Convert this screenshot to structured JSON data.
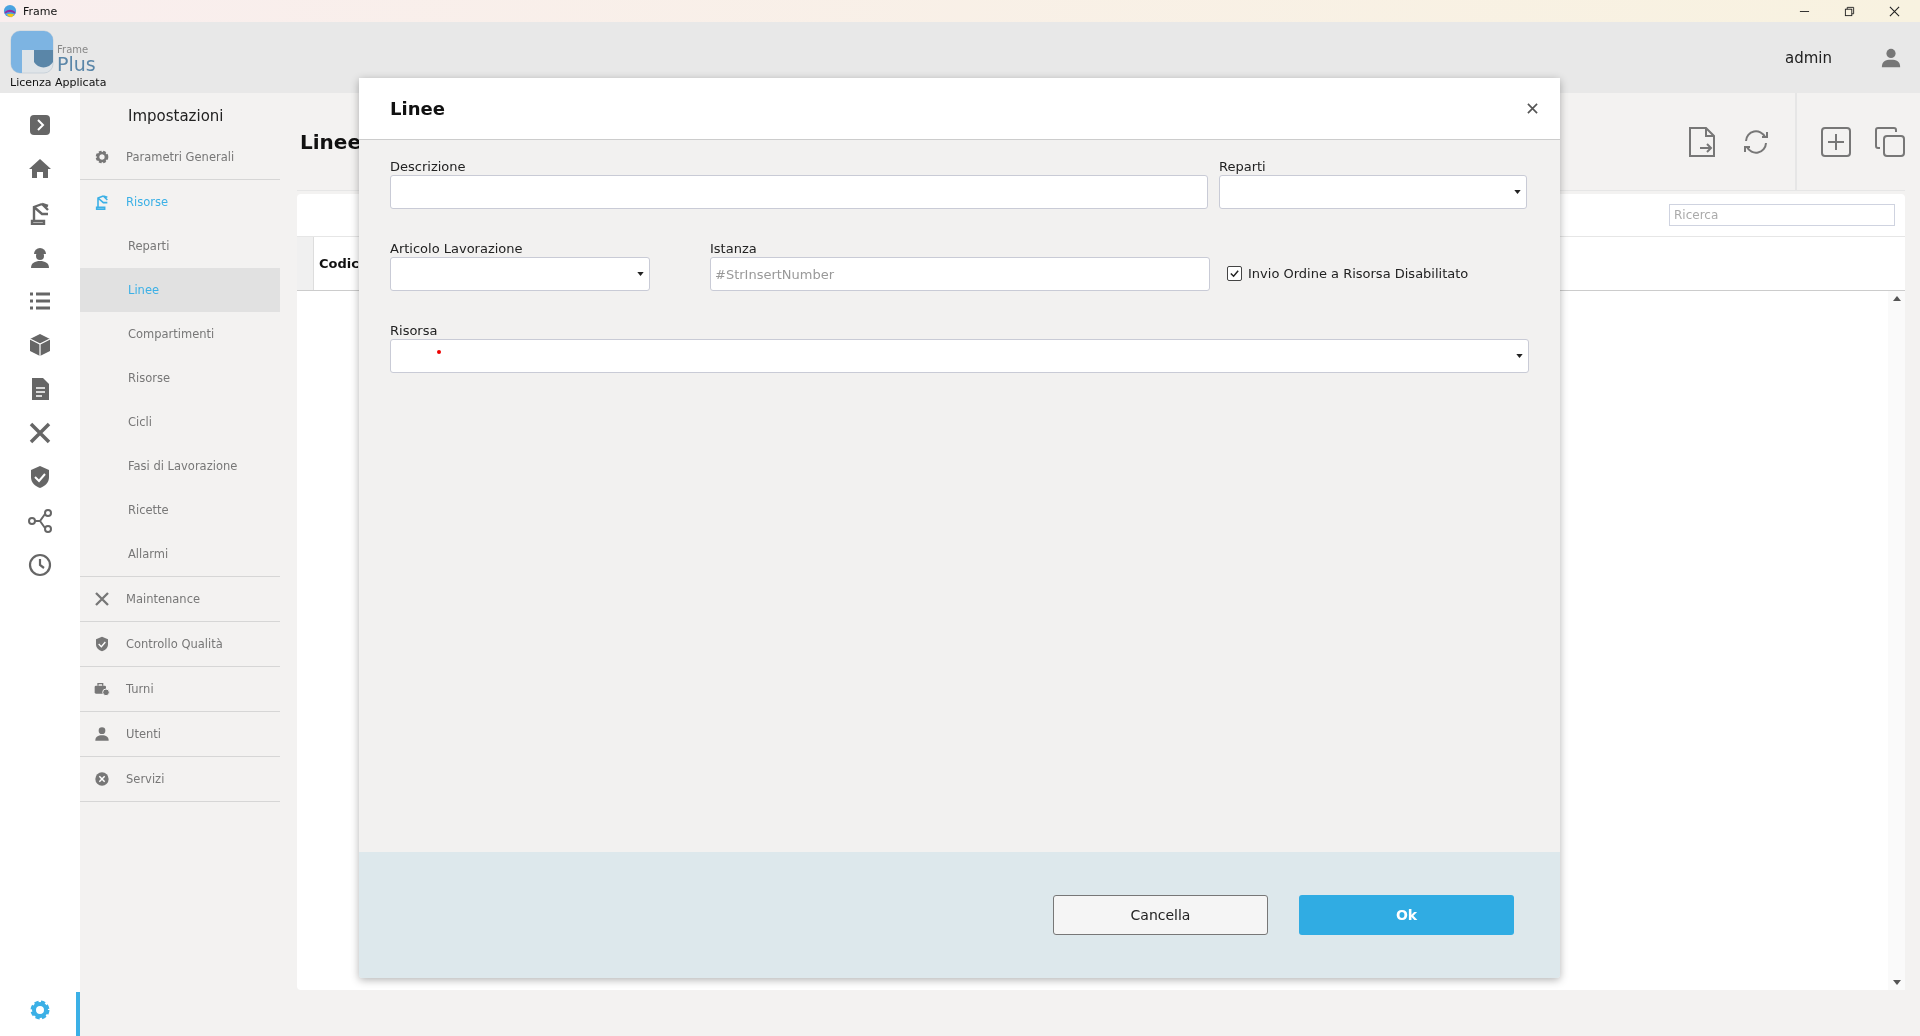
{
  "window": {
    "title": "Frame"
  },
  "logo": {
    "small": "Frame",
    "large": "Plus",
    "caption": "Licenza Applicata"
  },
  "user": {
    "name": "admin"
  },
  "rail": [
    {
      "kind": "expand",
      "selected": false
    },
    {
      "kind": "home",
      "selected": false
    },
    {
      "kind": "robot",
      "selected": false
    },
    {
      "kind": "worker",
      "selected": false
    },
    {
      "kind": "list",
      "selected": false
    },
    {
      "kind": "cube",
      "selected": false
    },
    {
      "kind": "document",
      "selected": false
    },
    {
      "kind": "tools",
      "selected": false
    },
    {
      "kind": "shield",
      "selected": false
    },
    {
      "kind": "share",
      "selected": false
    },
    {
      "kind": "clock",
      "selected": false
    },
    {
      "kind": "gear",
      "selected": true
    }
  ],
  "settings_menu": {
    "title": "Impostazioni",
    "items": [
      {
        "label": "Parametri Generali",
        "selected": false
      },
      {
        "label": "Risorse",
        "selected": true,
        "children": [
          {
            "label": "Reparti",
            "selected": false
          },
          {
            "label": "Linee",
            "selected": true
          },
          {
            "label": "Compartimenti",
            "selected": false
          },
          {
            "label": "Risorse",
            "selected": false
          },
          {
            "label": "Cicli",
            "selected": false
          },
          {
            "label": "Fasi di Lavorazione",
            "selected": false
          },
          {
            "label": "Ricette",
            "selected": false
          },
          {
            "label": "Allarmi",
            "selected": false
          }
        ]
      },
      {
        "label": "Maintenance",
        "selected": false
      },
      {
        "label": "Controllo Qualità",
        "selected": false
      },
      {
        "label": "Turni",
        "selected": false
      },
      {
        "label": "Utenti",
        "selected": false
      },
      {
        "label": "Servizi",
        "selected": false
      }
    ]
  },
  "page": {
    "title": "Linee",
    "search": {
      "placeholder": "Ricerca"
    },
    "table": {
      "columns": [
        "Codic"
      ]
    }
  },
  "dialog": {
    "title": "Linee",
    "rows": [
      [
        {
          "label": "Descrizione",
          "kind": "text"
        },
        {
          "label": "Reparti",
          "kind": "select"
        }
      ],
      [
        {
          "label": "Articolo Lavorazione",
          "kind": "select"
        },
        {
          "label": "Istanza",
          "kind": "text",
          "placeholder": "#StrInsertNumber"
        },
        {
          "label": "Invio Ordine a Risorsa Disabilitato",
          "kind": "checkbox",
          "checked": true
        }
      ],
      [
        {
          "label": "Risorsa",
          "kind": "select",
          "required": true
        }
      ]
    ],
    "buttons": [
      {
        "label": "Cancella",
        "kind": "secondary"
      },
      {
        "label": "Ok",
        "kind": "primary"
      }
    ]
  }
}
